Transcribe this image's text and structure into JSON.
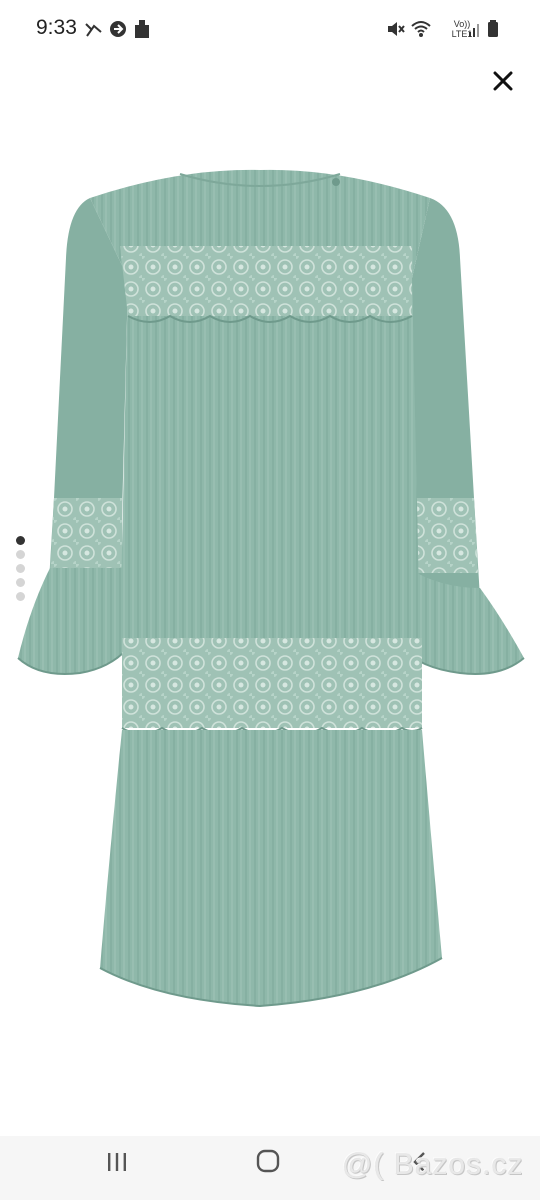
{
  "status_bar": {
    "time": "9:33",
    "left_icons": [
      "call-missed-icon",
      "sync-icon",
      "app-notification-icon"
    ],
    "right_icons": [
      "mute-icon",
      "wifi-icon",
      "signal-icon",
      "battery-icon"
    ],
    "volte_line1": "Vo))",
    "volte_line2": "LTE1"
  },
  "viewer": {
    "close_icon": "close-icon",
    "photo_subject": "dress-photo",
    "dress_color": "#8fb8aa",
    "lace_color": "#a3c4b8",
    "pages_total": 5,
    "current_page": 1
  },
  "nav_bar": {
    "icons": [
      "recents-icon",
      "home-icon",
      "back-icon"
    ]
  },
  "watermark": {
    "text": "@( Bazos.cz"
  }
}
